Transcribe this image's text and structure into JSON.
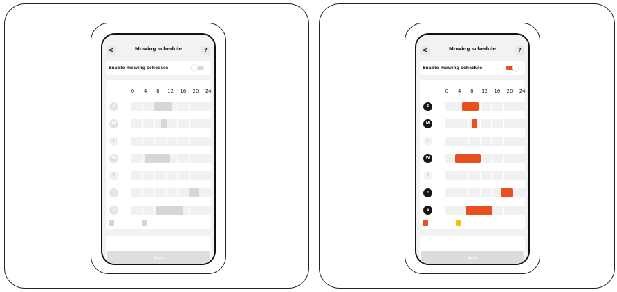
{
  "panels": [
    {
      "state": "disabled",
      "header": {
        "back_icon": "<",
        "title": "Mowing schedule",
        "help_icon": "?"
      },
      "enable": {
        "label": "Enable mowing schedule",
        "on": false
      },
      "hour_labels": [
        "0",
        "4",
        "8",
        "12",
        "16",
        "20",
        "24"
      ],
      "days": [
        {
          "letter": "S",
          "slots": [
            {
              "start": 7,
              "end": 12,
              "color": "a"
            }
          ]
        },
        {
          "letter": "M",
          "slots": [
            {
              "start": 9,
              "end": 10.5,
              "color": "a"
            }
          ]
        },
        {
          "letter": "T",
          "slots": []
        },
        {
          "letter": "W",
          "slots": [
            {
              "start": 4,
              "end": 11.5,
              "color": "a"
            }
          ]
        },
        {
          "letter": "T",
          "slots": []
        },
        {
          "letter": "F",
          "slots": [
            {
              "start": 17,
              "end": 20,
              "color": "a"
            }
          ]
        },
        {
          "letter": "S",
          "slots": [
            {
              "start": 7.5,
              "end": 15.5,
              "color": "a"
            }
          ]
        }
      ],
      "legend": [
        "a",
        "b"
      ],
      "save_label": "Save",
      "colors": {
        "a": "#d6d6d6",
        "b": "#d6d6d6",
        "day_filled": "#e4e4e4",
        "day_empty": "#f0f0f0",
        "save_bg": "#dedede"
      }
    },
    {
      "state": "enabled",
      "header": {
        "back_icon": "<",
        "title": "Mowing schedule",
        "help_icon": "?"
      },
      "enable": {
        "label": "Enable mowing schedule",
        "on": true
      },
      "hour_labels": [
        "0",
        "4",
        "8",
        "12",
        "16",
        "20",
        "24"
      ],
      "days": [
        {
          "letter": "S",
          "slots": [
            {
              "start": 5,
              "end": 10,
              "color": "a"
            }
          ]
        },
        {
          "letter": "M",
          "slots": [
            {
              "start": 8,
              "end": 9.5,
              "color": "a"
            }
          ]
        },
        {
          "letter": "T",
          "slots": []
        },
        {
          "letter": "W",
          "slots": [
            {
              "start": 3,
              "end": 10.5,
              "color": "a"
            }
          ]
        },
        {
          "letter": "T",
          "slots": []
        },
        {
          "letter": "F",
          "slots": [
            {
              "start": 16.5,
              "end": 20,
              "color": "a"
            }
          ]
        },
        {
          "letter": "S",
          "slots": [
            {
              "start": 6,
              "end": 14,
              "color": "a"
            }
          ]
        }
      ],
      "legend": [
        "a",
        "b"
      ],
      "save_label": "Save",
      "colors": {
        "a": "#e8501f",
        "b": "#f2c400",
        "day_filled": "#161616",
        "day_empty": "#f3f3f3",
        "save_bg": "#dcdcdc"
      }
    }
  ]
}
